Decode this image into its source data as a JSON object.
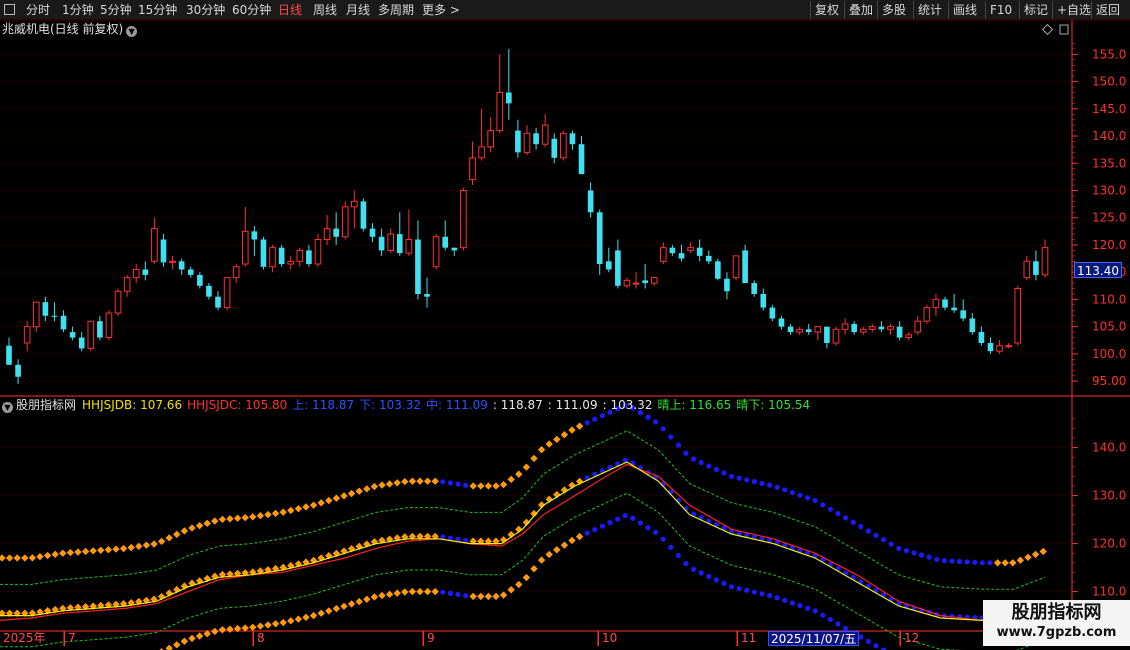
{
  "toolbar": {
    "periods": [
      {
        "label": "分时",
        "active": false
      },
      {
        "label": "1分钟",
        "active": false
      },
      {
        "label": "5分钟",
        "active": false
      },
      {
        "label": "15分钟",
        "active": false
      },
      {
        "label": "30分钟",
        "active": false
      },
      {
        "label": "60分钟",
        "active": false
      },
      {
        "label": "日线",
        "active": true
      },
      {
        "label": "周线",
        "active": false
      },
      {
        "label": "月线",
        "active": false
      },
      {
        "label": "多周期",
        "active": false
      }
    ],
    "more_label": "更多 >",
    "right_buttons": [
      "复权",
      "叠加",
      "多股",
      "统计",
      "画线",
      "F10",
      "标记",
      "+自选",
      "返回"
    ]
  },
  "main_chart": {
    "title": "兆威机电(日线 前复权)",
    "y_ticks": [
      "155.0",
      "150.0",
      "145.0",
      "140.0",
      "135.0",
      "130.0",
      "125.0",
      "120.0",
      "115.0",
      "110.0",
      "105.0",
      "100.0",
      "95.00"
    ],
    "current_price": "113.40"
  },
  "indicator": {
    "name": "股朋指标网",
    "items": [
      {
        "text": "HHJSJDB: 107.66",
        "color": "#f0e000"
      },
      {
        "text": "HHJSJDC: 105.80",
        "color": "#ff3030"
      },
      {
        "text": "上: 118.87",
        "color": "#3050ff"
      },
      {
        "text": "下: 103.32",
        "color": "#3050ff"
      },
      {
        "text": "中: 111.09",
        "color": "#3050ff"
      },
      {
        "text": ": 118.87",
        "color": "#e8e8e8"
      },
      {
        "text": ": 111.09",
        "color": "#e8e8e8"
      },
      {
        "text": ": 103.32",
        "color": "#e8e8e8"
      },
      {
        "text": "晴上: 116.65",
        "color": "#30e030"
      },
      {
        "text": "晴下: 105.54",
        "color": "#30e030"
      }
    ],
    "y_ticks": [
      "140.0",
      "130.0",
      "120.0",
      "110.0"
    ]
  },
  "date_axis": {
    "labels": [
      "2025年",
      "7",
      "8",
      "9",
      "10",
      "11",
      "12"
    ],
    "cursor_date": "2025/11/07/五"
  },
  "watermark": {
    "title": "股朋指标网",
    "url": "www.7gpzb.com"
  },
  "colors": {
    "up": "#ff3030",
    "down": "#40e0f0",
    "grid": "#5a0000",
    "axis": "#ff3030",
    "dots_orange": "#ff9a10",
    "dots_blue": "#1a1aff",
    "line_yellow": "#f0f000",
    "line_red": "#ff2020",
    "dash_green": "#20c020"
  },
  "chart_data": {
    "type": "candlestick",
    "title": "兆威机电(日线 前复权)",
    "ylim": [
      93,
      158
    ],
    "note_series": "daily OHLC, 2025",
    "ohlc": [
      [
        101.5,
        103,
        98,
        98
      ],
      [
        98,
        99,
        94.5,
        95.8
      ],
      [
        102,
        106,
        100.5,
        105
      ],
      [
        105,
        109,
        104,
        109.5
      ],
      [
        109.5,
        110.5,
        106,
        107
      ],
      [
        107,
        109.5,
        106,
        106.8
      ],
      [
        107,
        108,
        104,
        104.5
      ],
      [
        104,
        105,
        102.5,
        103
      ],
      [
        103,
        104,
        100.5,
        101
      ],
      [
        101,
        106,
        100.5,
        106
      ],
      [
        106,
        107,
        102.5,
        103
      ],
      [
        103,
        108,
        102.5,
        107.5
      ],
      [
        107.5,
        112,
        107,
        111.5
      ],
      [
        111.5,
        114.5,
        110.5,
        114
      ],
      [
        114,
        116.5,
        113,
        115.5
      ],
      [
        115.5,
        117,
        113.5,
        114.5
      ],
      [
        117,
        125,
        116.5,
        123
      ],
      [
        121,
        122,
        116,
        116.8
      ],
      [
        116.8,
        118,
        115.5,
        117
      ],
      [
        117,
        117.5,
        114.5,
        115.5
      ],
      [
        115.5,
        116,
        114,
        114.5
      ],
      [
        114.5,
        115,
        112,
        112.5
      ],
      [
        112.5,
        113,
        110,
        110.5
      ],
      [
        110.5,
        111.5,
        108,
        108.5
      ],
      [
        108.5,
        114,
        108,
        114
      ],
      [
        114,
        116.5,
        113,
        116
      ],
      [
        116.5,
        127,
        116,
        122.5
      ],
      [
        122.5,
        123.5,
        118,
        121
      ],
      [
        121,
        121.5,
        115.5,
        116
      ],
      [
        116,
        120,
        115,
        119.5
      ],
      [
        119.5,
        120,
        116,
        116.5
      ],
      [
        116.5,
        118,
        115.5,
        117
      ],
      [
        117,
        119.5,
        116,
        119
      ],
      [
        119,
        120,
        116,
        116.5
      ],
      [
        116.5,
        122,
        116,
        121
      ],
      [
        121,
        125.5,
        120,
        123
      ],
      [
        123,
        126,
        120,
        121.5
      ],
      [
        121.5,
        128,
        121,
        127
      ],
      [
        127,
        130,
        123,
        128
      ],
      [
        128,
        128.5,
        122.5,
        123
      ],
      [
        123,
        124,
        120.5,
        121.5
      ],
      [
        121.5,
        123,
        118,
        119
      ],
      [
        119,
        123,
        118.5,
        122
      ],
      [
        122,
        126,
        118,
        118.5
      ],
      [
        118.5,
        126.5,
        118,
        121
      ],
      [
        121,
        124.5,
        110,
        111
      ],
      [
        111,
        114,
        108.5,
        110.5
      ],
      [
        116,
        122,
        115.5,
        121.5
      ],
      [
        121.5,
        124.5,
        119,
        119.5
      ],
      [
        119.5,
        119.5,
        118,
        119
      ],
      [
        119.5,
        130.5,
        119,
        130
      ],
      [
        132,
        139,
        131,
        136
      ],
      [
        136,
        145,
        135.5,
        138
      ],
      [
        138,
        143.5,
        137,
        141
      ],
      [
        141,
        155,
        140.5,
        148
      ],
      [
        148,
        156,
        143,
        146
      ],
      [
        141,
        143,
        136,
        137
      ],
      [
        137,
        142,
        136.5,
        140.5
      ],
      [
        140.5,
        141.5,
        137.5,
        138.5
      ],
      [
        138.5,
        144,
        138,
        142
      ],
      [
        139.5,
        140.5,
        135,
        136
      ],
      [
        136,
        141,
        135.5,
        140.5
      ],
      [
        140.5,
        141,
        137.5,
        138.5
      ],
      [
        138.5,
        140,
        133,
        133
      ],
      [
        130,
        131.5,
        125,
        126
      ],
      [
        126,
        126.5,
        114.5,
        116.5
      ],
      [
        117,
        119.5,
        115,
        115.5
      ],
      [
        119,
        121,
        112,
        112.5
      ],
      [
        112.5,
        114,
        112,
        113.5
      ],
      [
        113,
        115,
        112,
        113
      ],
      [
        113.5,
        116.5,
        112,
        113
      ],
      [
        113,
        114,
        112.5,
        114
      ],
      [
        117,
        120.5,
        116.5,
        119.5
      ],
      [
        119.5,
        120,
        118,
        118.5
      ],
      [
        118.5,
        120,
        117,
        117.5
      ],
      [
        119,
        120.5,
        118.5,
        119.5
      ],
      [
        119.5,
        121,
        117,
        118
      ],
      [
        118,
        119,
        116.5,
        117
      ],
      [
        117,
        117.5,
        113.5,
        113.8
      ],
      [
        113.8,
        115,
        110,
        111.5
      ],
      [
        114,
        118,
        113.5,
        118
      ],
      [
        119,
        120,
        113.5,
        113
      ],
      [
        113,
        113.5,
        110.5,
        111
      ],
      [
        111,
        112,
        108,
        108.5
      ],
      [
        108.5,
        109,
        106,
        106.5
      ],
      [
        106.5,
        107,
        104.5,
        105
      ],
      [
        105,
        105.5,
        103.5,
        104
      ],
      [
        104,
        105,
        103.5,
        104.5
      ],
      [
        104.5,
        105.5,
        103.5,
        104
      ],
      [
        104,
        105,
        102.5,
        105
      ],
      [
        105,
        105,
        101,
        102
      ],
      [
        102,
        105,
        101.5,
        104.5
      ],
      [
        104.5,
        106.5,
        103.5,
        105.5
      ],
      [
        105.5,
        106,
        103.5,
        104
      ],
      [
        104,
        105,
        103.5,
        104.5
      ],
      [
        104.5,
        105.5,
        104,
        105
      ],
      [
        105,
        106,
        104,
        104.5
      ],
      [
        104.5,
        105.5,
        103.5,
        105
      ],
      [
        105,
        106,
        102.5,
        103
      ],
      [
        103,
        104,
        102.5,
        103.5
      ],
      [
        104,
        107,
        103.5,
        106
      ],
      [
        106,
        109,
        105.5,
        108.5
      ],
      [
        108.5,
        111,
        107,
        110
      ],
      [
        110,
        110.5,
        108,
        108.5
      ],
      [
        108.5,
        111,
        107.5,
        108
      ],
      [
        108,
        110,
        106,
        106.5
      ],
      [
        106.5,
        107.5,
        103.5,
        104
      ],
      [
        104,
        105,
        101.5,
        102
      ],
      [
        102,
        103,
        100,
        100.5
      ],
      [
        100.5,
        102.5,
        100,
        101.5
      ],
      [
        101.5,
        102,
        101,
        101.5
      ],
      [
        102,
        112.5,
        101.5,
        112
      ],
      [
        114,
        118,
        113.5,
        117
      ],
      [
        117,
        119,
        113.5,
        114.5
      ],
      [
        114.5,
        121,
        114,
        119.5
      ]
    ]
  },
  "indicator_data": {
    "type": "line",
    "ylim": [
      102,
      147
    ],
    "x_norm": [
      0,
      0.03,
      0.06,
      0.09,
      0.12,
      0.15,
      0.18,
      0.21,
      0.24,
      0.27,
      0.3,
      0.33,
      0.36,
      0.39,
      0.42,
      0.45,
      0.48,
      0.5,
      0.52,
      0.55,
      0.58,
      0.6,
      0.63,
      0.66,
      0.7,
      0.74,
      0.78,
      0.82,
      0.86,
      0.9,
      0.94,
      0.97,
      1
    ],
    "yellow": [
      105,
      105,
      106,
      106.5,
      107,
      108,
      111,
      113,
      113.5,
      114.5,
      116,
      118,
      120,
      121,
      121,
      120,
      120,
      123,
      128,
      132,
      135,
      137,
      133,
      126,
      122,
      120,
      117,
      112,
      107,
      104.5,
      104,
      104,
      106.5
    ],
    "red": [
      104,
      104.5,
      105.5,
      106,
      106.5,
      107.5,
      110,
      112.5,
      113.5,
      114,
      115.5,
      117,
      119,
      120.5,
      121,
      120,
      119.5,
      122,
      126,
      130,
      134,
      136.5,
      134,
      128,
      123,
      121,
      118,
      113.5,
      108,
      105,
      104,
      103.8,
      105
    ]
  }
}
